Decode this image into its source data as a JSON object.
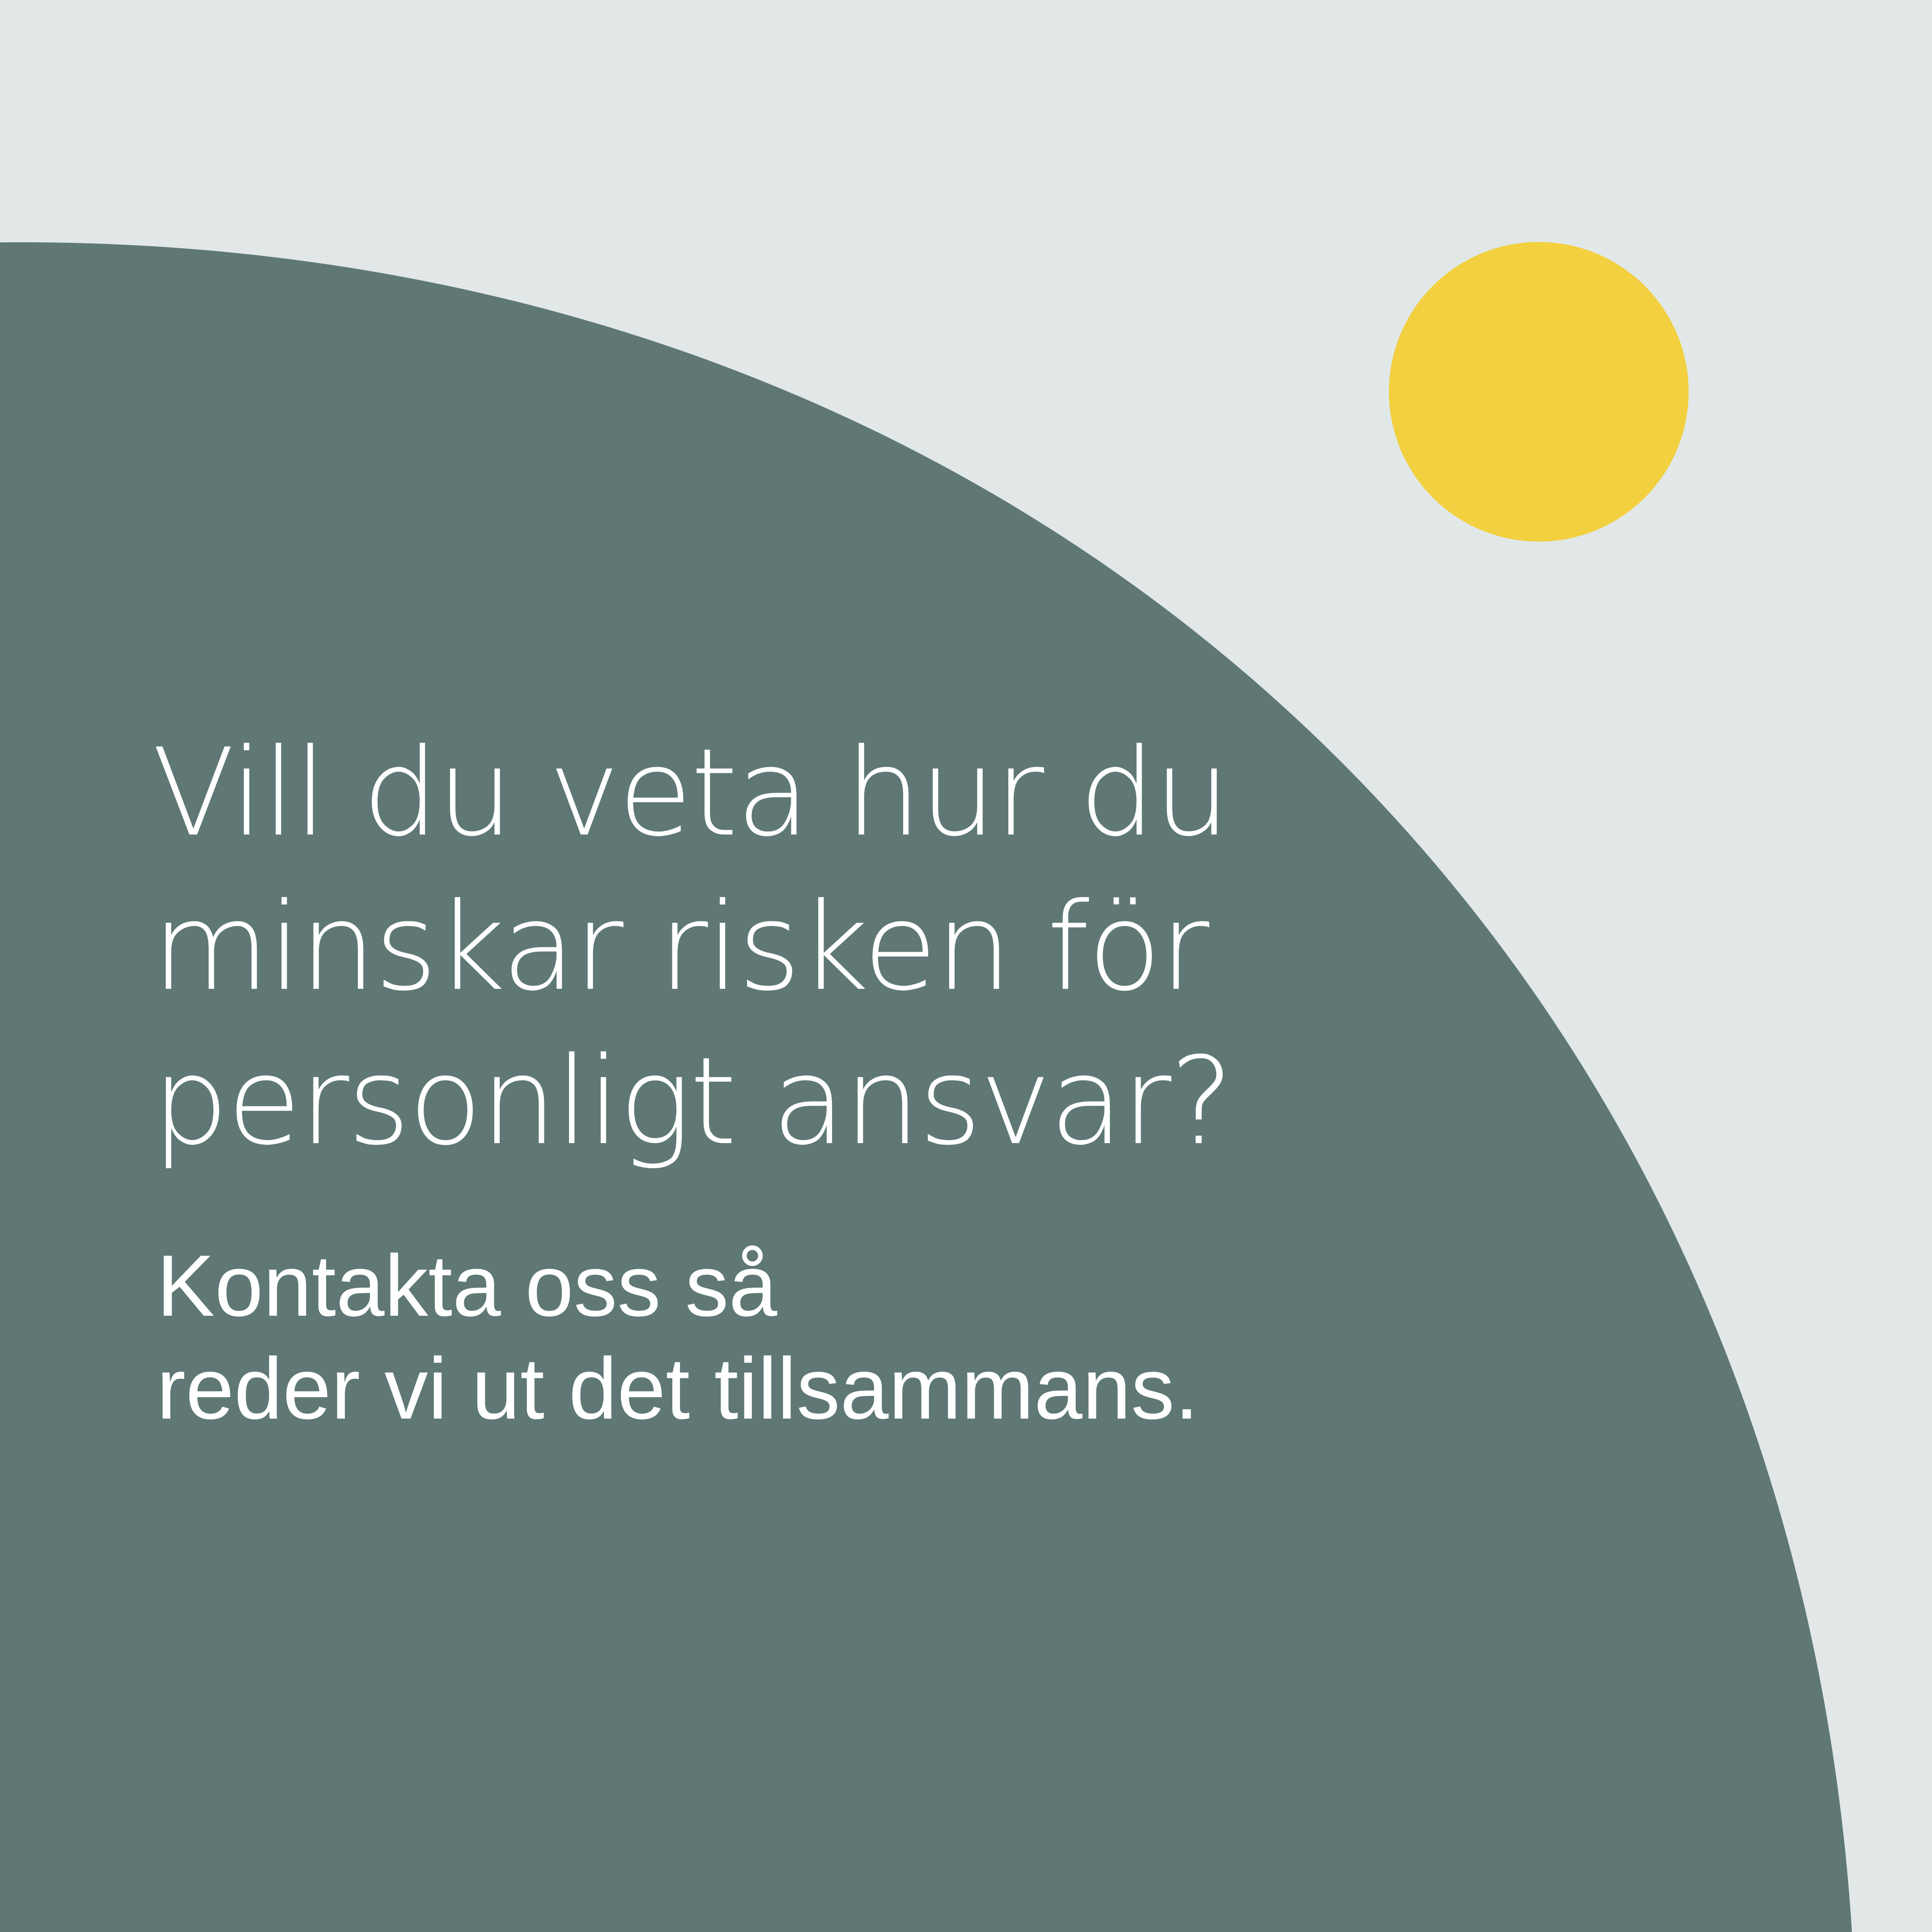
{
  "colors": {
    "background": "#e1e8e7",
    "arc": "#5f7875",
    "sun": "#f2d03f",
    "text": "#ffffff"
  },
  "headline": {
    "lines": [
      "Vill du veta hur du",
      "minskar risken för",
      "personligt ansvar?"
    ]
  },
  "subtext": {
    "lines": [
      "Kontakta oss så",
      "reder vi ut det tillsammans."
    ]
  }
}
